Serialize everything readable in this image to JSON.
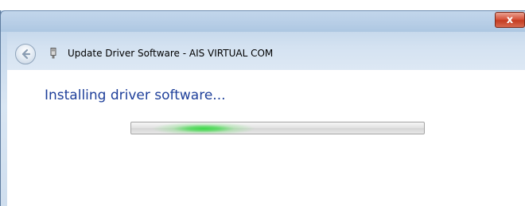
{
  "window": {
    "title": "Update Driver Software - AIS VIRTUAL COM",
    "close_label": "x",
    "close_color": "#c43d22"
  },
  "header": {
    "back_icon": "back-arrow-icon",
    "device_icon": "usb-device-icon"
  },
  "main": {
    "heading": "Installing driver software...",
    "heading_color": "#1e3f9a",
    "progress": {
      "state": "indeterminate",
      "glow_color": "#3fd94a"
    }
  }
}
